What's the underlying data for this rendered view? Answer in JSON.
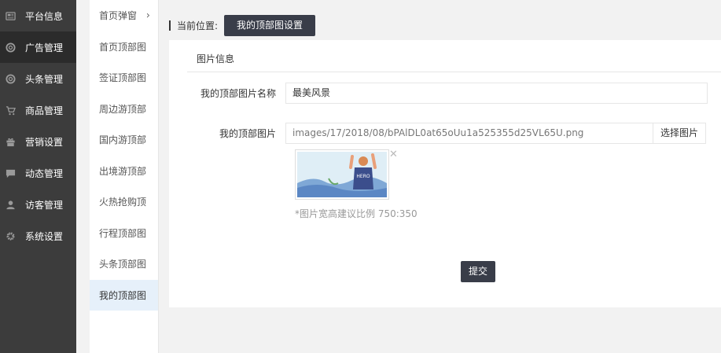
{
  "sidebar": {
    "items": [
      {
        "label": "平台信息",
        "icon": "newspaper-icon"
      },
      {
        "label": "广告管理",
        "icon": "lifebuoy-icon"
      },
      {
        "label": "头条管理",
        "icon": "lifebuoy-icon"
      },
      {
        "label": "商品管理",
        "icon": "cart-icon"
      },
      {
        "label": "营销设置",
        "icon": "gift-icon"
      },
      {
        "label": "动态管理",
        "icon": "chat-icon"
      },
      {
        "label": "访客管理",
        "icon": "user-icon"
      },
      {
        "label": "系统设置",
        "icon": "gear-icon"
      }
    ],
    "active_index": 1
  },
  "submenu": {
    "items": [
      "首页弹窗",
      "首页顶部图",
      "签证顶部图",
      "周边游顶部",
      "国内游顶部",
      "出境游顶部",
      "火热抢购顶",
      "行程顶部图",
      "头条顶部图",
      "我的顶部图"
    ],
    "active_index": 9
  },
  "breadcrumb": {
    "label": "当前位置:",
    "current": "我的顶部图设置"
  },
  "panel": {
    "title": "图片信息",
    "name_label": "我的顶部图片名称",
    "name_value": "最美风景",
    "image_label": "我的顶部图片",
    "image_path": "images/17/2018/08/bPAlDL0at65oUu1a525355d25VL65U.png",
    "pick_button": "选择图片",
    "thumb_text": "HERO",
    "hint": "*图片宽高建议比例 750:350",
    "submit": "提交"
  },
  "colors": {
    "sidebar_bg": "#3c3c3c",
    "dark_button": "#393d49",
    "submenu_active": "#e6f0fa"
  }
}
